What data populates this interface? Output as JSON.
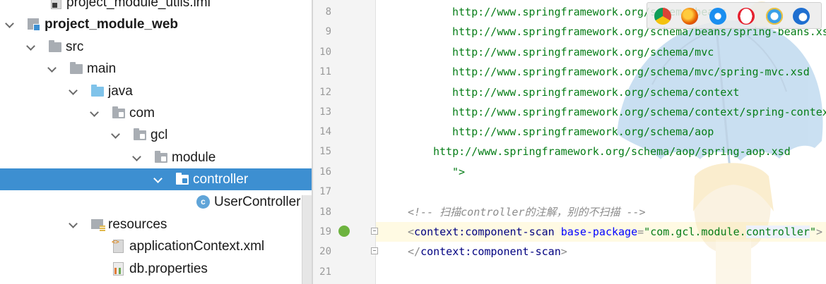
{
  "project_tree": {
    "items": [
      {
        "label": "project_module_utils.iml",
        "bold": false,
        "icon": "iml-file-icon",
        "expanded": null
      },
      {
        "label": "project_module_web",
        "bold": true,
        "icon": "module-icon",
        "expanded": true
      },
      {
        "label": "src",
        "bold": false,
        "icon": "folder-icon",
        "expanded": true
      },
      {
        "label": "main",
        "bold": false,
        "icon": "folder-icon",
        "expanded": true
      },
      {
        "label": "java",
        "bold": false,
        "icon": "source-folder-icon",
        "expanded": true
      },
      {
        "label": "com",
        "bold": false,
        "icon": "package-icon",
        "expanded": true
      },
      {
        "label": "gcl",
        "bold": false,
        "icon": "package-icon",
        "expanded": true
      },
      {
        "label": "module",
        "bold": false,
        "icon": "package-icon",
        "expanded": true
      },
      {
        "label": "controller",
        "bold": false,
        "icon": "package-icon",
        "expanded": true,
        "selected": true
      },
      {
        "label": "UserController",
        "bold": false,
        "icon": "java-class-icon",
        "expanded": null
      },
      {
        "label": "resources",
        "bold": false,
        "icon": "resources-folder-icon",
        "expanded": true
      },
      {
        "label": "applicationContext.xml",
        "bold": false,
        "icon": "xml-file-icon",
        "expanded": null
      },
      {
        "label": "db.properties",
        "bold": false,
        "icon": "properties-file-icon",
        "expanded": null
      }
    ],
    "selection_color": "#3d8fd1"
  },
  "editor": {
    "lines": [
      {
        "n": "8",
        "kind": "url",
        "text": "http://www.springframework.org/schema/beans"
      },
      {
        "n": "9",
        "kind": "url",
        "text": "http://www.springframework.org/schema/beans/spring-beans.xsd"
      },
      {
        "n": "10",
        "kind": "url",
        "text": "http://www.springframework.org/schema/mvc"
      },
      {
        "n": "11",
        "kind": "url",
        "text": "http://www.springframework.org/schema/mvc/spring-mvc.xsd"
      },
      {
        "n": "12",
        "kind": "url",
        "text": "http://www.springframework.org/schema/context"
      },
      {
        "n": "13",
        "kind": "url",
        "text": "http://www.springframework.org/schema/context/spring-context.xsd"
      },
      {
        "n": "14",
        "kind": "url",
        "text": "http://www.springframework.org/schema/aop"
      },
      {
        "n": "15",
        "kind": "url",
        "text": "http://www.springframework.org/schema/aop/spring-aop.xsd"
      },
      {
        "n": "16",
        "kind": "close",
        "text": "\">"
      },
      {
        "n": "17",
        "kind": "blank",
        "text": ""
      },
      {
        "n": "18",
        "kind": "comment",
        "text": "<!-- 扫描controller的注解，别的不扫描 -->"
      },
      {
        "n": "19",
        "kind": "open-tag",
        "text": ""
      },
      {
        "n": "20",
        "kind": "close-tag",
        "text": ""
      },
      {
        "n": "21",
        "kind": "blank",
        "text": ""
      }
    ],
    "line19": {
      "lt": "<",
      "ns": "context",
      "colon": ":",
      "tag": "component-scan",
      "attr": "base-package",
      "eq": "=",
      "q1": "\"",
      "val_prefix": "com.gcl.module.",
      "val_hl": "controller",
      "q2": "\"",
      "gt": ">"
    },
    "line20": {
      "lt": "</",
      "ns": "context",
      "colon": ":",
      "tag": "component-scan",
      "gt": ">"
    }
  },
  "colors": {
    "url": "#067d17",
    "tag": "#000080",
    "attr": "#0000ff",
    "comment": "#8c8c8c",
    "current_line": "#fffae3"
  },
  "browser_icons": [
    "chrome-icon",
    "firefox-icon",
    "safari-icon",
    "opera-icon",
    "internet-explorer-icon",
    "edge-icon"
  ]
}
